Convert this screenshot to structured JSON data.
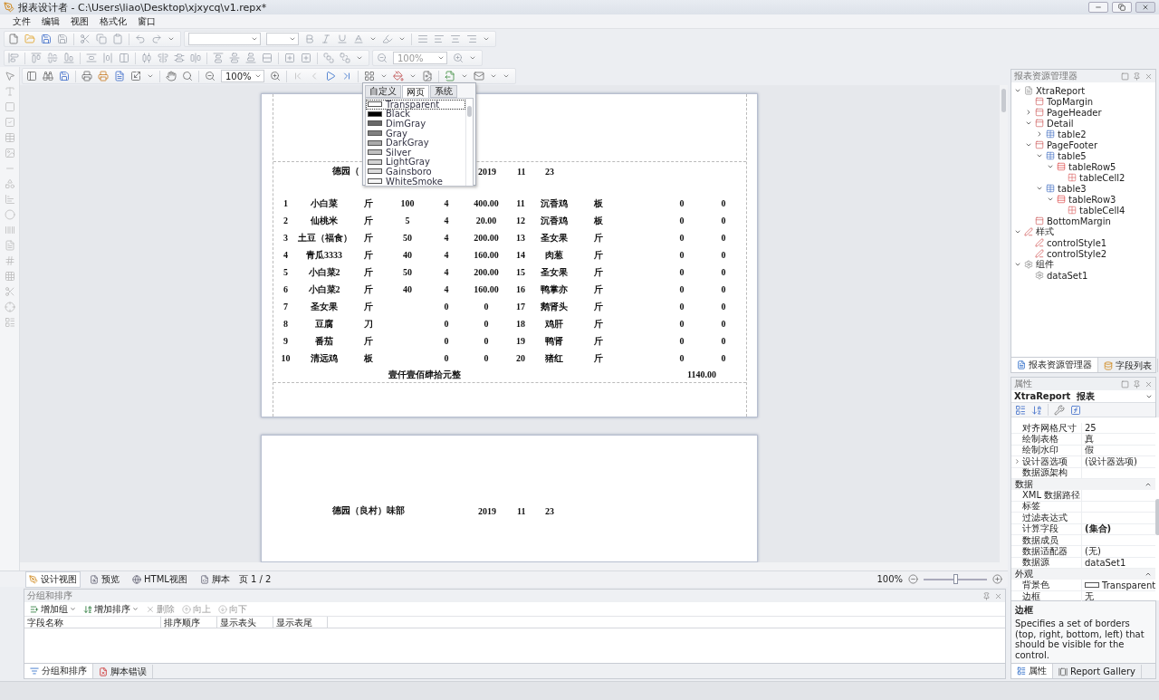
{
  "window": {
    "title": "报表设计者 - C:\\Users\\liao\\Desktop\\xjxycq\\v1.repx*"
  },
  "menu": [
    "文件",
    "编辑",
    "视图",
    "格式化",
    "窗口"
  ],
  "layout_toolbar": {
    "zoom": "100%"
  },
  "preview_toolbar": {
    "zoom": "100%"
  },
  "color_popup": {
    "tabs": [
      {
        "label": "自定义",
        "selected": false
      },
      {
        "label": "网页",
        "selected": true
      },
      {
        "label": "系统",
        "selected": false
      }
    ],
    "colors": [
      {
        "name": "Transparent",
        "color": "#ffffff",
        "selected": true
      },
      {
        "name": "Black",
        "color": "#000000",
        "selected": false
      },
      {
        "name": "DimGray",
        "color": "#696969",
        "selected": false
      },
      {
        "name": "Gray",
        "color": "#808080",
        "selected": false
      },
      {
        "name": "DarkGray",
        "color": "#a9a9a9",
        "selected": false
      },
      {
        "name": "Silver",
        "color": "#c0c0c0",
        "selected": false
      },
      {
        "name": "LightGray",
        "color": "#d3d3d3",
        "selected": false
      },
      {
        "name": "Gainsboro",
        "color": "#dcdcdc",
        "selected": false
      },
      {
        "name": "WhiteSmoke",
        "color": "#f5f5f5",
        "selected": false
      }
    ]
  },
  "report_pages": [
    {
      "title": "德园（",
      "year": "2019",
      "month": "11",
      "day": "23",
      "rows": [
        [
          "1",
          "小白菜",
          "斤",
          "100",
          "4",
          "400.00",
          "11",
          "沉香鸡",
          "板",
          "0",
          "0"
        ],
        [
          "2",
          "仙桃米",
          "斤",
          "5",
          "4",
          "20.00",
          "12",
          "沉香鸡",
          "板",
          "0",
          "0"
        ],
        [
          "3",
          "土豆（福食）",
          "斤",
          "50",
          "4",
          "200.00",
          "13",
          "圣女果",
          "斤",
          "0",
          "0"
        ],
        [
          "4",
          "青瓜3333",
          "斤",
          "40",
          "4",
          "160.00",
          "14",
          "肉葱",
          "斤",
          "0",
          "0"
        ],
        [
          "5",
          "小白菜2",
          "斤",
          "50",
          "4",
          "200.00",
          "15",
          "圣女果",
          "斤",
          "0",
          "0"
        ],
        [
          "6",
          "小白菜2",
          "斤",
          "40",
          "4",
          "160.00",
          "16",
          "鸭掌亦",
          "斤",
          "0",
          "0"
        ],
        [
          "7",
          "圣女果",
          "斤",
          "",
          "0",
          "0",
          "17",
          "鹅肾头",
          "斤",
          "0",
          "0"
        ],
        [
          "8",
          "豆腐",
          "刀",
          "",
          "0",
          "0",
          "18",
          "鸡肝",
          "斤",
          "0",
          "0"
        ],
        [
          "9",
          "番茄",
          "斤",
          "",
          "0",
          "0",
          "19",
          "鸭肾",
          "斤",
          "0",
          "0"
        ],
        [
          "10",
          "清远鸡",
          "板",
          "",
          "0",
          "0",
          "20",
          "猪红",
          "斤",
          "0",
          "0"
        ]
      ],
      "total_words": "壹仟壹佰肆拾元整",
      "total_amount": "1140.00"
    },
    {
      "title": "德园（良村）味部",
      "year": "2019",
      "month": "11",
      "day": "23"
    }
  ],
  "explorer": {
    "title": "报表资源管理器",
    "tree": [
      {
        "label": "XtraReport",
        "kind": "report",
        "expanded": true,
        "children": [
          {
            "label": "TopMargin",
            "kind": "band"
          },
          {
            "label": "PageHeader",
            "kind": "band",
            "expanded": false
          },
          {
            "label": "Detail",
            "kind": "band",
            "expanded": true,
            "children": [
              {
                "label": "table2",
                "kind": "table",
                "expanded": false
              }
            ]
          },
          {
            "label": "PageFooter",
            "kind": "band",
            "expanded": true,
            "children": [
              {
                "label": "table5",
                "kind": "table",
                "expanded": true,
                "children": [
                  {
                    "label": "tableRow5",
                    "kind": "row",
                    "expanded": true,
                    "children": [
                      {
                        "label": "tableCell2",
                        "kind": "cell"
                      }
                    ]
                  }
                ]
              },
              {
                "label": "table3",
                "kind": "table",
                "expanded": true,
                "children": [
                  {
                    "label": "tableRow3",
                    "kind": "row",
                    "expanded": true,
                    "children": [
                      {
                        "label": "tableCell4",
                        "kind": "cell"
                      }
                    ]
                  }
                ]
              }
            ]
          },
          {
            "label": "BottomMargin",
            "kind": "band"
          }
        ]
      },
      {
        "label": "样式",
        "kind": "style",
        "expanded": true,
        "children": [
          {
            "label": "controlStyle1",
            "kind": "style"
          },
          {
            "label": "controlStyle2",
            "kind": "style"
          }
        ]
      },
      {
        "label": "组件",
        "kind": "gear",
        "expanded": true,
        "children": [
          {
            "label": "dataSet1",
            "kind": "gear"
          }
        ]
      }
    ],
    "tabs": [
      {
        "label": "报表资源管理器",
        "selected": true
      },
      {
        "label": "字段列表",
        "selected": false
      }
    ]
  },
  "properties": {
    "title": "属性",
    "object": "XtraReport",
    "object_type": "报表",
    "rows": [
      {
        "kind": "row",
        "name": "对齐网格尺寸",
        "value": "25"
      },
      {
        "kind": "row",
        "name": "绘制表格",
        "value": "真"
      },
      {
        "kind": "row",
        "name": "绘制水印",
        "value": "假"
      },
      {
        "kind": "group",
        "name": "设计器选项",
        "value": "(设计器选项)",
        "expanded": false
      },
      {
        "kind": "row",
        "name": "数据源架构"
      },
      {
        "kind": "category",
        "name": "数据",
        "expanded": true
      },
      {
        "kind": "row",
        "name": "XML 数据路径"
      },
      {
        "kind": "row",
        "name": "标签"
      },
      {
        "kind": "row",
        "name": "过滤表达式"
      },
      {
        "kind": "collection",
        "name": "计算字段",
        "value": "(集合)"
      },
      {
        "kind": "row",
        "name": "数据成员"
      },
      {
        "kind": "row",
        "name": "数据适配器",
        "value": "(无)"
      },
      {
        "kind": "row",
        "name": "数据源",
        "value": "dataSet1"
      },
      {
        "kind": "category",
        "name": "外观",
        "expanded": true
      },
      {
        "kind": "color",
        "name": "背景色",
        "value": "Transparent",
        "color": "#ffffff"
      },
      {
        "kind": "row",
        "name": "边框",
        "value": "无"
      }
    ],
    "description_title": "边框",
    "description": "Specifies a set of borders (top, right, bottom, left) that should be visible for the control.",
    "tabs": [
      {
        "label": "属性",
        "selected": true
      },
      {
        "label": "Report Gallery",
        "selected": false
      }
    ]
  },
  "view_tabs": [
    {
      "label": "设计视图",
      "selected": true
    },
    {
      "label": "预览",
      "selected": false
    },
    {
      "label": "HTML视图",
      "selected": false
    },
    {
      "label": "脚本",
      "selected": false
    }
  ],
  "page_indicator": "页 1 / 2",
  "zoom": {
    "reading": "100%",
    "level": 0.5
  },
  "group_sort": {
    "title": "分组和排序",
    "actions": [
      {
        "label": "增加组",
        "disabled": false,
        "dropdown": true
      },
      {
        "label": "增加排序",
        "disabled": false,
        "dropdown": true
      },
      {
        "label": "删除",
        "disabled": true,
        "dropdown": false
      },
      {
        "label": "向上",
        "disabled": true,
        "dropdown": false
      },
      {
        "label": "向下",
        "disabled": true,
        "dropdown": false
      }
    ],
    "columns": [
      "字段名称",
      "排序顺序",
      "显示表头",
      "显示表尾"
    ],
    "tabs": [
      {
        "label": "分组和排序",
        "selected": true
      },
      {
        "label": "脚本错误",
        "selected": false
      }
    ]
  }
}
